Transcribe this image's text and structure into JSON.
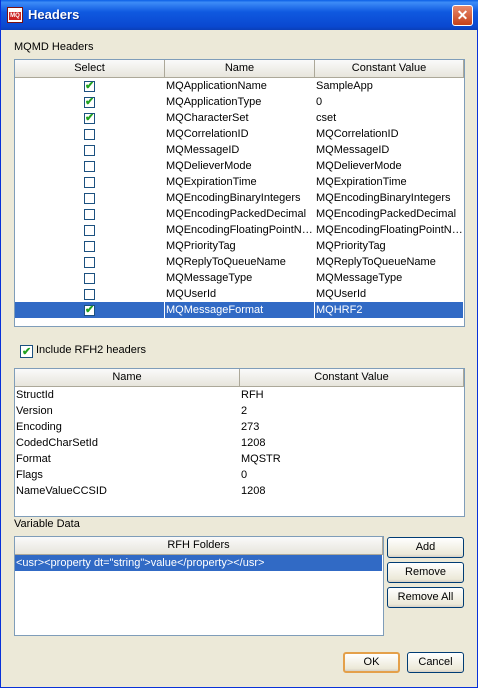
{
  "window": {
    "title": "Headers",
    "close_glyph": "✕",
    "icon": "mq-app-icon",
    "icon_text": "MQ"
  },
  "mqmd": {
    "section_label": "MQMD Headers",
    "columns": [
      "Select",
      "Name",
      "Constant Value"
    ],
    "rows": [
      {
        "checked": true,
        "name": "MQApplicationName",
        "value": "SampleApp"
      },
      {
        "checked": true,
        "name": "MQApplicationType",
        "value": "0"
      },
      {
        "checked": true,
        "name": "MQCharacterSet",
        "value": "cset"
      },
      {
        "checked": false,
        "name": "MQCorrelationID",
        "value": "MQCorrelationID"
      },
      {
        "checked": false,
        "name": "MQMessageID",
        "value": "MQMessageID"
      },
      {
        "checked": false,
        "name": "MQDelieverMode",
        "value": "MQDelieverMode"
      },
      {
        "checked": false,
        "name": "MQExpirationTime",
        "value": "MQExpirationTime"
      },
      {
        "checked": false,
        "name": "MQEncodingBinaryIntegers",
        "value": "MQEncodingBinaryIntegers"
      },
      {
        "checked": false,
        "name": "MQEncodingPackedDecimal",
        "value": "MQEncodingPackedDecimal"
      },
      {
        "checked": false,
        "name": "MQEncodingFloatingPointNu...",
        "value": "MQEncodingFloatingPointNu..."
      },
      {
        "checked": false,
        "name": "MQPriorityTag",
        "value": "MQPriorityTag"
      },
      {
        "checked": false,
        "name": "MQReplyToQueueName",
        "value": "MQReplyToQueueName"
      },
      {
        "checked": false,
        "name": "MQMessageType",
        "value": "MQMessageType"
      },
      {
        "checked": false,
        "name": "MQUserId",
        "value": "MQUserId"
      },
      {
        "checked": true,
        "name": "MQMessageFormat",
        "value": "MQHRF2",
        "selected": true
      }
    ]
  },
  "rfh2": {
    "include_label": "Include RFH2 headers",
    "include_checked": true,
    "columns": [
      "Name",
      "Constant Value"
    ],
    "rows": [
      {
        "name": "StructId",
        "value": "RFH"
      },
      {
        "name": "Version",
        "value": "2"
      },
      {
        "name": "Encoding",
        "value": "273"
      },
      {
        "name": "CodedCharSetId",
        "value": "1208"
      },
      {
        "name": "Format",
        "value": "MQSTR"
      },
      {
        "name": "Flags",
        "value": "0"
      },
      {
        "name": "NameValueCCSID",
        "value": "1208"
      }
    ]
  },
  "variable": {
    "section_label": "Variable Data",
    "column": "RFH Folders",
    "rows": [
      {
        "value": "<usr><property dt=\"string\">value</property></usr>",
        "selected": true
      }
    ],
    "buttons": {
      "add": "Add",
      "remove": "Remove",
      "remove_all": "Remove All"
    }
  },
  "footer": {
    "ok": "OK",
    "cancel": "Cancel"
  },
  "colors": {
    "selection": "#316ac5",
    "title_bar": "#0a5fe6",
    "check": "#21a121"
  }
}
